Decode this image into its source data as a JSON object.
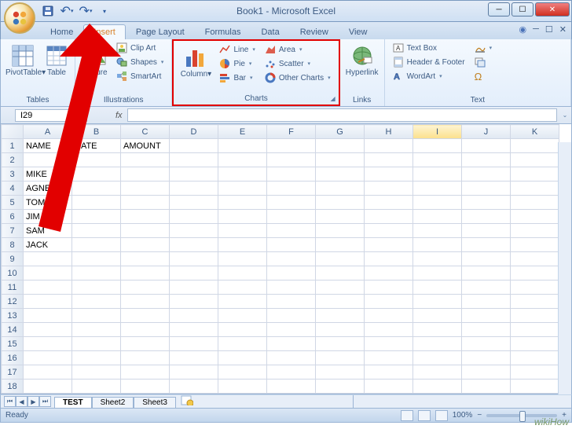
{
  "title": "Book1 - Microsoft Excel",
  "qat": {
    "save": "💾",
    "undo": "↶",
    "redo": "↷"
  },
  "tabs": [
    "Home",
    "Insert",
    "Page Layout",
    "Formulas",
    "Data",
    "Review",
    "View"
  ],
  "active_tab_index": 1,
  "ribbon": {
    "tables": {
      "label": "Tables",
      "pivot": "PivotTable",
      "table": "Table"
    },
    "illustrations": {
      "label": "Illustrations",
      "picture": "Picture",
      "clipart": "Clip Art",
      "shapes": "Shapes",
      "smartart": "SmartArt"
    },
    "charts": {
      "label": "Charts",
      "column": "Column",
      "line": "Line",
      "pie": "Pie",
      "bar": "Bar",
      "area": "Area",
      "scatter": "Scatter",
      "other": "Other Charts"
    },
    "links": {
      "label": "Links",
      "hyperlink": "Hyperlink"
    },
    "text": {
      "label": "Text",
      "textbox": "Text Box",
      "headerfooter": "Header & Footer",
      "wordart": "WordArt",
      "signature": "Signature",
      "object": "Object",
      "symbol": "Ω"
    }
  },
  "name_box": "I29",
  "fx": "fx",
  "columns": [
    "A",
    "B",
    "C",
    "D",
    "E",
    "F",
    "G",
    "H",
    "I",
    "J",
    "K"
  ],
  "selected_col": "I",
  "rows": 18,
  "cells": {
    "A1": "NAME",
    "B1": "DATE",
    "C1": "AMOUNT",
    "A3": "MIKE",
    "A4": "AGNES",
    "A5": "TOM",
    "A6": "JIM",
    "A7": "SAM",
    "A8": "JACK"
  },
  "sheets": [
    "TEST",
    "Sheet2",
    "Sheet3"
  ],
  "active_sheet_index": 0,
  "status": {
    "ready": "Ready",
    "zoom": "100%"
  },
  "watermark": "wikiHow"
}
